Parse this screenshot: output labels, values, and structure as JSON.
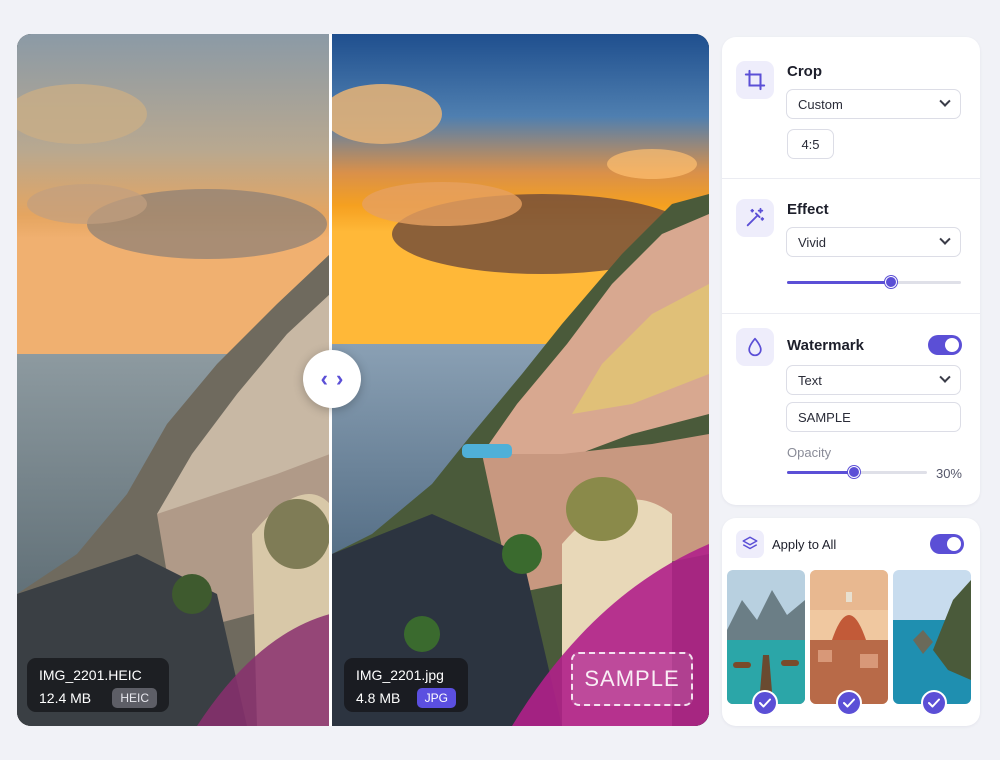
{
  "compare": {
    "original": {
      "filename": "IMG_2201.HEIC",
      "size": "12.4 MB",
      "format": "HEIC"
    },
    "converted": {
      "filename": "IMG_2201.jpg",
      "size": "4.8 MB",
      "format": "JPG"
    },
    "watermark_preview": "SAMPLE",
    "handle_left": "‹",
    "handle_right": "›"
  },
  "settings": {
    "crop": {
      "label": "Crop",
      "mode": "Custom",
      "ratio": "4:5",
      "icon": "crop-icon"
    },
    "effect": {
      "label": "Effect",
      "preset": "Vivid",
      "intensity_fraction": 0.6,
      "icon": "magic-wand-icon"
    },
    "watermark": {
      "label": "Watermark",
      "enabled": true,
      "type": "Text",
      "text": "SAMPLE",
      "opacity_label": "Opacity",
      "opacity_value": "30%",
      "opacity_fraction": 0.48,
      "icon": "droplet-icon"
    }
  },
  "apply_all": {
    "label": "Apply to All",
    "enabled": true,
    "icon": "layers-icon",
    "thumbnails": [
      {
        "name": "mountain-lake",
        "selected": true
      },
      {
        "name": "florence-dome",
        "selected": true
      },
      {
        "name": "coastal-cliffs",
        "selected": true
      }
    ]
  },
  "colors": {
    "accent": "#5b4fd6",
    "jpg_badge": "#5b4fe0",
    "heic_badge": "#5d5e66",
    "background": "#f1f2f7"
  }
}
